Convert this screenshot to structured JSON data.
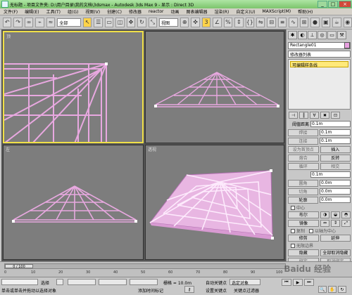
{
  "titlebar": {
    "left_label": "无标题",
    "title": "- 项目文件夹: D:\\用户目录\\我的文档\\3dsmax - Autodesk 3ds Max 9 - 显示 : Direct 3D"
  },
  "menu": [
    "文件(F)",
    "编辑(E)",
    "工具(T)",
    "组(G)",
    "视图(V)",
    "创建(C)",
    "修改器",
    "reactor",
    "动画",
    "图表编辑器",
    "渲染(R)",
    "自定义(U)",
    "MAXScript(M)",
    "帮助(H)"
  ],
  "toolbar": {
    "selection_filter": "全部",
    "ref_coord": "视图"
  },
  "viewports": {
    "top_label": "顶",
    "front_label": "",
    "left_label": "左",
    "persp_label": "透视"
  },
  "command_panel": {
    "object_name": "Rectangle01",
    "modifier_list": "修改器列表",
    "stack_item": "可编辑样条线",
    "rows": {
      "connect_distance": "阈值距离",
      "connect_distance_val": "0.1m",
      "weld": "焊接",
      "weld_val": "0.1m",
      "connect": "连接",
      "connect_val": "0.1m",
      "insert": "插入",
      "set_first": "设为首顶点",
      "fuse": "熔合",
      "reverse": "反转",
      "cycle": "循环",
      "cross_insert": "相交",
      "cross_val": "0.1m",
      "fillet": "圆角",
      "fillet_val": "0.0m",
      "chamfer": "切角",
      "chamfer_val": "0.0m",
      "outline": "轮廓",
      "outline_val": "0.0m",
      "center": "中心",
      "bool": "布尔",
      "mirror": "镜像",
      "copy_chk": "复制",
      "about_pivot": "以轴为中心",
      "trim": "修剪",
      "extend": "延伸",
      "infinite_bounds": "无限边界",
      "hide": "隐藏",
      "unhide_all": "全部取消隐藏",
      "bind": "绑定",
      "unbind": "取消绑定"
    }
  },
  "timeline": {
    "frame": "0 / 100",
    "ticks": [
      "0",
      "10",
      "20",
      "30",
      "40",
      "50",
      "60",
      "70",
      "80",
      "90",
      "100"
    ]
  },
  "status": {
    "selected": "选择",
    "hint": "单击或单击并拖动以选择对象",
    "grid": "栅格 = 10.0m",
    "autokey": "自动关键点",
    "select_obj": "选定对象",
    "set_key": "设置关键点",
    "key_filter": "关键点过滤器",
    "add_time_tag": "添加时间标记"
  },
  "watermark": "Baidu 经验"
}
